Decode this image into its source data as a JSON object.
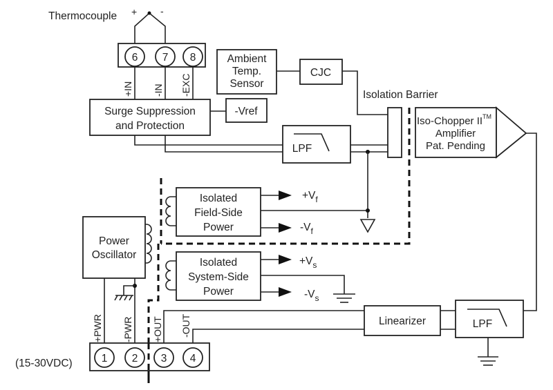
{
  "diagram": {
    "title_label": "Thermocouple",
    "thermocouple_plus": "+",
    "thermocouple_minus": "-",
    "input_terminals": [
      {
        "number": "6",
        "label": "+IN"
      },
      {
        "number": "7",
        "label": "-IN"
      },
      {
        "number": "8",
        "label": "-EXC"
      }
    ],
    "output_terminals": [
      {
        "number": "1",
        "label": "+PWR"
      },
      {
        "number": "2",
        "label": "-PWR"
      },
      {
        "number": "3",
        "label": "+OUT"
      },
      {
        "number": "4",
        "label": "-OUT"
      }
    ],
    "supply_range": "(15-30VDC)",
    "blocks": {
      "ambient_sensor": [
        "Ambient",
        "Temp.",
        "Sensor"
      ],
      "cjc": "CJC",
      "surge": [
        "Surge Suppression",
        "and Protection"
      ],
      "vref": "-Vref",
      "lpf_input": "LPF",
      "isolation_barrier": "Isolation Barrier",
      "amplifier": [
        "Iso-Chopper II",
        "TM",
        "Amplifier",
        "Pat. Pending"
      ],
      "field_power": [
        "Isolated",
        "Field-Side",
        "Power"
      ],
      "system_power": [
        "Isolated",
        "System-Side",
        "Power"
      ],
      "oscillator": [
        "Power",
        "Oscillator"
      ],
      "linearizer": "Linearizer",
      "lpf_output": "LPF"
    },
    "rails": {
      "vf_plus": {
        "main": "+V",
        "sub": "f"
      },
      "vf_minus": {
        "main": "-V",
        "sub": "f"
      },
      "vs_plus": {
        "main": "+V",
        "sub": "s"
      },
      "vs_minus": {
        "main": "-V",
        "sub": "s"
      }
    }
  }
}
